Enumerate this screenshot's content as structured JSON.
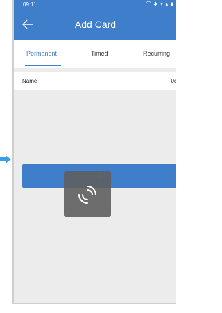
{
  "status": {
    "time": "09:11",
    "icons": "⌒ ✱ ▾ ▴ ▮"
  },
  "appbar": {
    "title": "Add Card"
  },
  "tabs": [
    {
      "label": "Permanent",
      "active": true
    },
    {
      "label": "Timed",
      "active": false
    },
    {
      "label": "Recurring",
      "active": false
    }
  ],
  "form": {
    "name_label": "Name",
    "name_value": "0c"
  },
  "ok_button": {
    "label": "OK"
  },
  "colors": {
    "accent": "#3f7ecb",
    "page_bg": "#ececec"
  }
}
